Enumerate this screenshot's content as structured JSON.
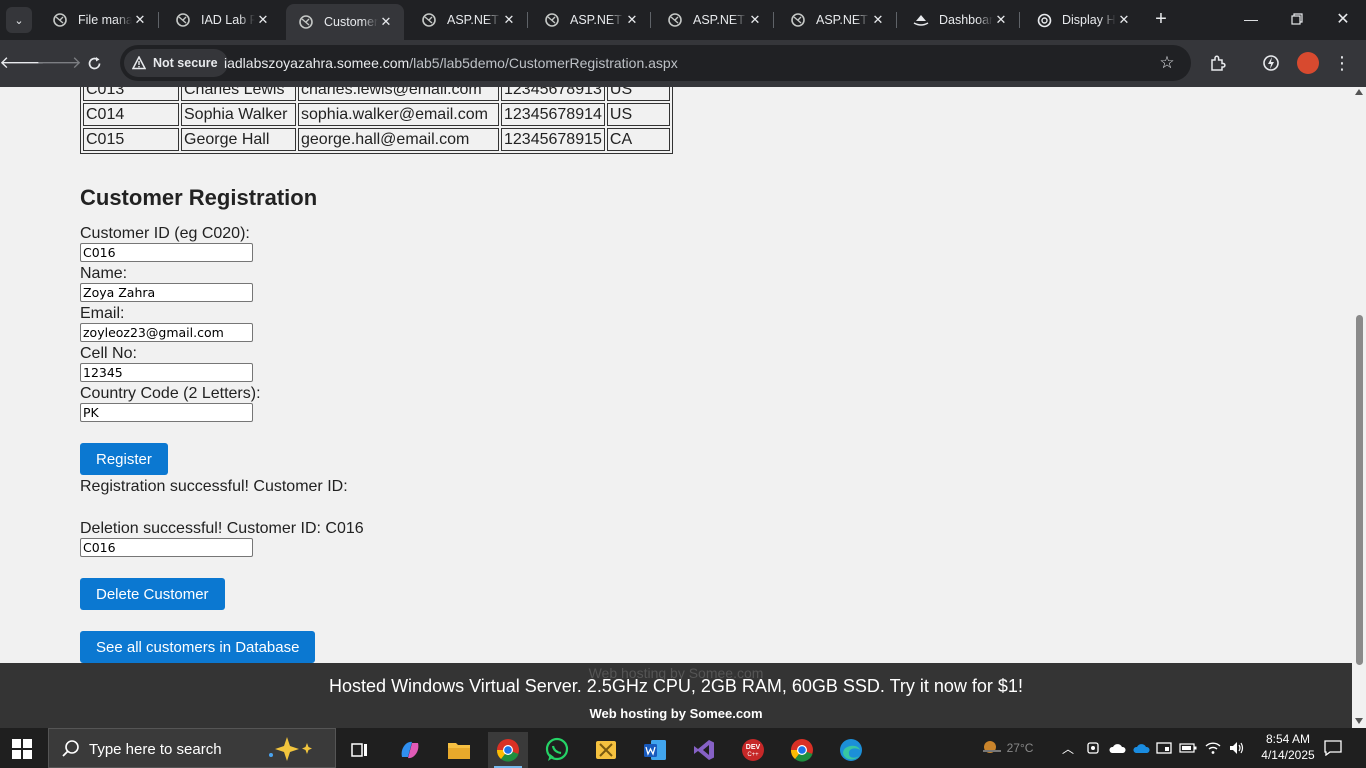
{
  "browser": {
    "tabs": [
      {
        "title": "File manager",
        "active": false
      },
      {
        "title": "IAD Lab Programs",
        "active": false
      },
      {
        "title": "Customer Registration",
        "active": true
      },
      {
        "title": "ASP.NET Core",
        "active": false
      },
      {
        "title": "ASP.NET Core",
        "active": false
      },
      {
        "title": "ASP.NET Core",
        "active": false
      },
      {
        "title": "ASP.NET Core",
        "active": false
      },
      {
        "title": "Dashboard",
        "active": false
      },
      {
        "title": "Display HTML",
        "active": false
      }
    ],
    "security_label": "Not secure",
    "url_host": "iadlabszoyazahra.somee.com",
    "url_path": "/lab5/lab5demo/CustomerRegistration.aspx"
  },
  "customers_table": {
    "rows": [
      [
        "C013",
        "Charles Lewis",
        "charles.lewis@email.com",
        "12345678913",
        "US"
      ],
      [
        "C014",
        "Sophia Walker",
        "sophia.walker@email.com",
        "12345678914",
        "US"
      ],
      [
        "C015",
        "George Hall",
        "george.hall@email.com",
        "12345678915",
        "CA"
      ]
    ]
  },
  "form": {
    "heading": "Customer Registration",
    "customer_id_label": "Customer ID (eg C020):",
    "customer_id_value": "C016",
    "name_label": "Name:",
    "name_value": "Zoya Zahra",
    "email_label": "Email:",
    "email_value": "zoyleoz23@gmail.com",
    "cell_label": "Cell No:",
    "cell_value": "12345",
    "country_label": "Country Code (2 Letters):",
    "country_value": "PK",
    "register_button": "Register",
    "registration_message": "Registration successful! Customer ID:",
    "deletion_message": "Deletion successful! Customer ID: C016",
    "delete_id_value": "C016",
    "delete_button": "Delete Customer",
    "see_all_button": "See all customers in Database"
  },
  "banner": {
    "ghost_text": "Web hosting by Somee.com",
    "main_text": "Hosted Windows Virtual Server. 2.5GHz CPU, 2GB RAM, 60GB SSD. Try it now for $1!",
    "sub_text": "Web hosting by Somee.com"
  },
  "taskbar": {
    "search_placeholder": "Type here to search",
    "weather": "27°C",
    "time": "8:54 AM",
    "date": "4/14/2025"
  },
  "colors": {
    "button_blue": "#0b78d1",
    "chrome_dark": "#202124",
    "chrome_toolbar": "#35363a",
    "banner_bg": "#343434"
  }
}
